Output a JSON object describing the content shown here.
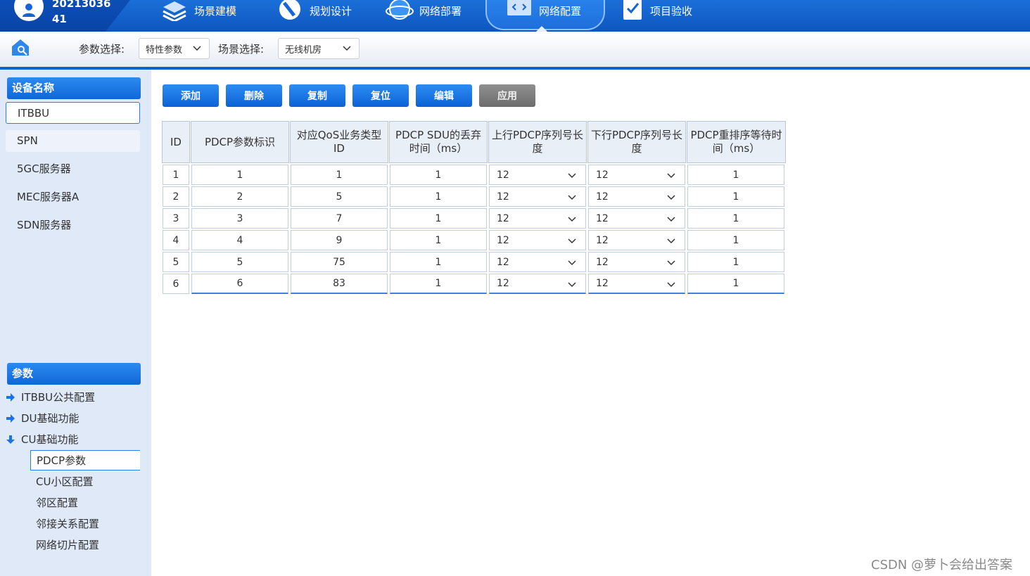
{
  "header": {
    "user_id_line1": "20213036",
    "user_id_line2": "41",
    "nav": [
      {
        "label": "场景建模",
        "icon": "layers-icon"
      },
      {
        "label": "规划设计",
        "icon": "compass-icon"
      },
      {
        "label": "网络部署",
        "icon": "globe-icon"
      },
      {
        "label": "网络配置",
        "icon": "monitor-code-icon"
      },
      {
        "label": "项目验收",
        "icon": "clipboard-check-icon"
      }
    ],
    "active_nav": "网络配置"
  },
  "subbar": {
    "param_label": "参数选择:",
    "param_value": "特性参数",
    "scene_label": "场景选择:",
    "scene_value": "无线机房"
  },
  "sidebar": {
    "device_header": "设备名称",
    "devices": [
      "ITBBU",
      "SPN",
      "5GC服务器",
      "MEC服务器A",
      "SDN服务器"
    ],
    "selected_device": "ITBBU",
    "param_header": "参数",
    "params": [
      {
        "label": "ITBBU公共配置",
        "expanded": false
      },
      {
        "label": "DU基础功能",
        "expanded": false
      },
      {
        "label": "CU基础功能",
        "expanded": true
      }
    ],
    "cu_children": [
      "PDCP参数",
      "CU小区配置",
      "邻区配置",
      "邻接关系配置",
      "网络切片配置"
    ],
    "selected_child": "PDCP参数"
  },
  "toolbar": {
    "add": "添加",
    "delete": "删除",
    "copy": "复制",
    "reset": "复位",
    "edit": "编辑",
    "apply": "应用"
  },
  "table": {
    "headers": [
      "ID",
      "PDCP参数标识",
      "对应QoS业务类型ID",
      "PDCP SDU的丢弃时间（ms）",
      "上行PDCP序列号长度",
      "下行PDCP序列号长度",
      "PDCP重排序等待时间（ms）"
    ],
    "rows": [
      {
        "id": "1",
        "pdcp_id": "1",
        "qos_id": "1",
        "discard": "1",
        "ul_sn": "12",
        "dl_sn": "12",
        "reorder": "1"
      },
      {
        "id": "2",
        "pdcp_id": "2",
        "qos_id": "5",
        "discard": "1",
        "ul_sn": "12",
        "dl_sn": "12",
        "reorder": "1"
      },
      {
        "id": "3",
        "pdcp_id": "3",
        "qos_id": "7",
        "discard": "1",
        "ul_sn": "12",
        "dl_sn": "12",
        "reorder": "1"
      },
      {
        "id": "4",
        "pdcp_id": "4",
        "qos_id": "9",
        "discard": "1",
        "ul_sn": "12",
        "dl_sn": "12",
        "reorder": "1"
      },
      {
        "id": "5",
        "pdcp_id": "5",
        "qos_id": "75",
        "discard": "1",
        "ul_sn": "12",
        "dl_sn": "12",
        "reorder": "1"
      },
      {
        "id": "6",
        "pdcp_id": "6",
        "qos_id": "83",
        "discard": "1",
        "ul_sn": "12",
        "dl_sn": "12",
        "reorder": "1"
      }
    ]
  },
  "watermark": "CSDN @萝卜会给出答案",
  "colors": {
    "primary": "#0f67d8",
    "sidebar_bg": "#dfe9f8",
    "disabled": "#7a7a7a"
  }
}
